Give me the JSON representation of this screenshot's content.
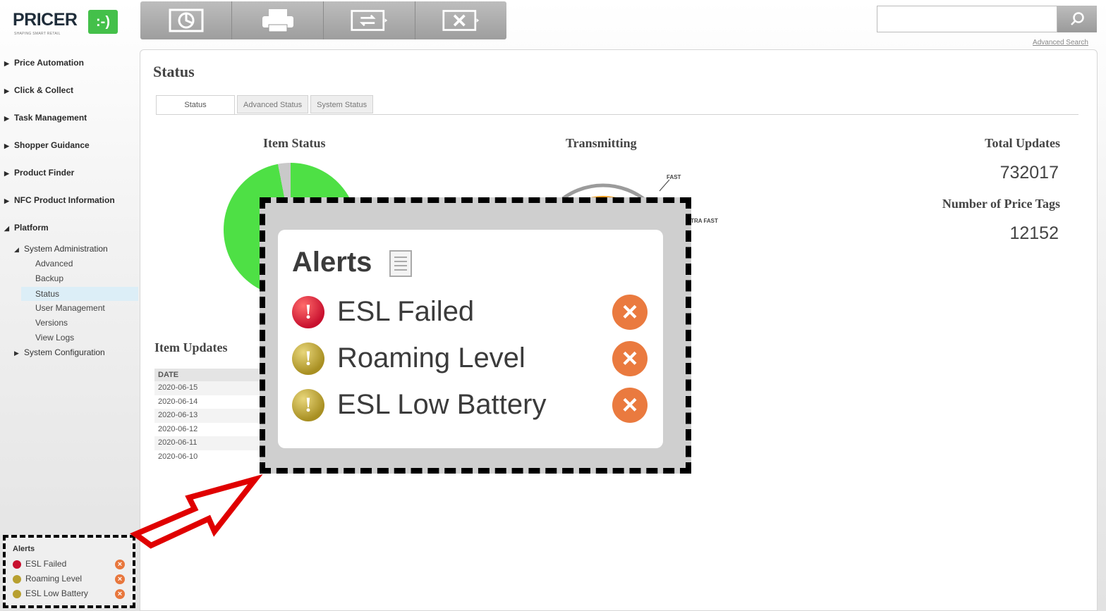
{
  "brand": {
    "name": "PRICER",
    "logo_glyph": ":-)",
    "tagline": "SHAPING SMART RETAIL",
    "accent": "#44c04a"
  },
  "toolbar": {
    "icons": [
      "map-icon",
      "print-icon",
      "transfer-icon",
      "clear-icon"
    ]
  },
  "search": {
    "value": "",
    "advanced_label": "Advanced Search"
  },
  "sidebar": {
    "items": [
      {
        "label": "Price Automation"
      },
      {
        "label": "Click & Collect"
      },
      {
        "label": "Task Management"
      },
      {
        "label": "Shopper Guidance"
      },
      {
        "label": "Product Finder"
      },
      {
        "label": "NFC Product Information"
      },
      {
        "label": "Platform"
      }
    ],
    "system_admin": "System Administration",
    "admin_items": [
      "Advanced",
      "Backup",
      "Status",
      "User Management",
      "Versions",
      "View Logs"
    ],
    "selected": "Status",
    "system_config": "System Configuration"
  },
  "main": {
    "title": "Status",
    "tabs": [
      "Status",
      "Advanced Status",
      "System Status"
    ],
    "item_status_title": "Item Status",
    "transmitting_title": "Transmitting",
    "gauge_labels": {
      "fast": "FAST",
      "ultra_fast": "ULTRA FAST"
    },
    "total_updates_label": "Total Updates",
    "total_updates_value": "732017",
    "price_tags_label": "Number of Price Tags",
    "price_tags_value": "12152",
    "item_updates_title": "Item Updates",
    "updates_table": {
      "header": "DATE",
      "rows": [
        "2020-06-15",
        "2020-06-14",
        "2020-06-13",
        "2020-06-12",
        "2020-06-11",
        "2020-06-10"
      ]
    }
  },
  "alerts": {
    "title": "Alerts",
    "items": [
      {
        "label": "ESL Failed",
        "severity": "error",
        "color": "#c8102e"
      },
      {
        "label": "Roaming Level",
        "severity": "warning",
        "color": "#b8a030"
      },
      {
        "label": "ESL Low Battery",
        "severity": "warning",
        "color": "#b8a030"
      }
    ],
    "dismiss_color": "#ea7a3f"
  }
}
